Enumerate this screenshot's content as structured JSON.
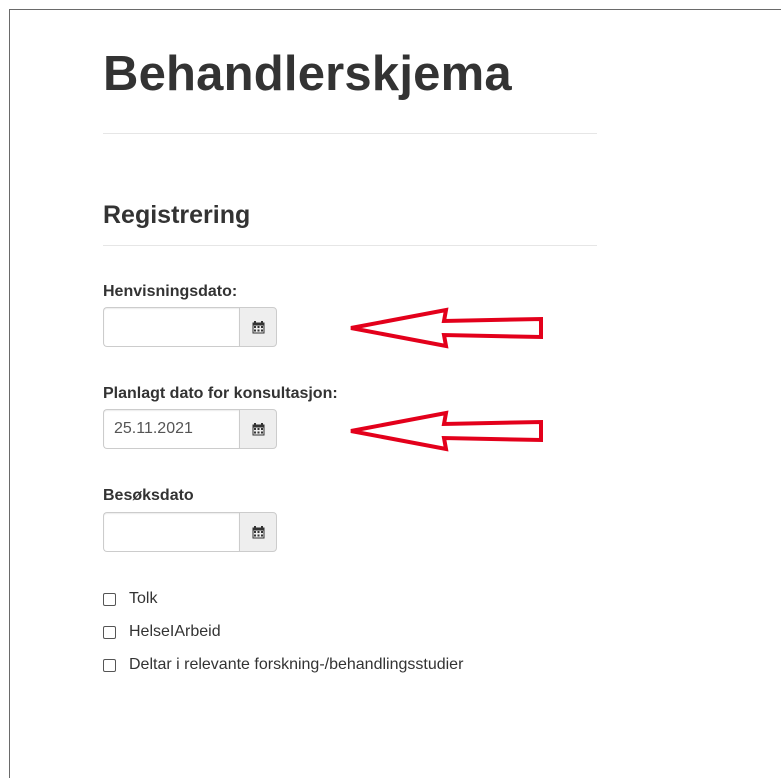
{
  "page": {
    "title": "Behandlerskjema"
  },
  "section": {
    "title": "Registrering"
  },
  "fields": [
    {
      "label": "Henvisningsdato:",
      "value": "",
      "icon": "calendar-icon"
    },
    {
      "label": "Planlagt dato for konsultasjon:",
      "value": "25.11.2021",
      "icon": "calendar-icon"
    },
    {
      "label": "Besøksdato",
      "value": "",
      "icon": "calendar-icon"
    }
  ],
  "checkboxes": [
    {
      "label": "Tolk",
      "checked": false
    },
    {
      "label": "HelseIArbeid",
      "checked": false
    },
    {
      "label": "Deltar i relevante forskning-/behandlingsstudier",
      "checked": false
    }
  ],
  "annotations": {
    "arrow_color": "#e3001b",
    "arrows": [
      "red-arrow-icon",
      "red-arrow-icon"
    ]
  },
  "colors": {
    "text": "#333333",
    "input_border": "#cccccc",
    "addon_background": "#eeeeee"
  }
}
